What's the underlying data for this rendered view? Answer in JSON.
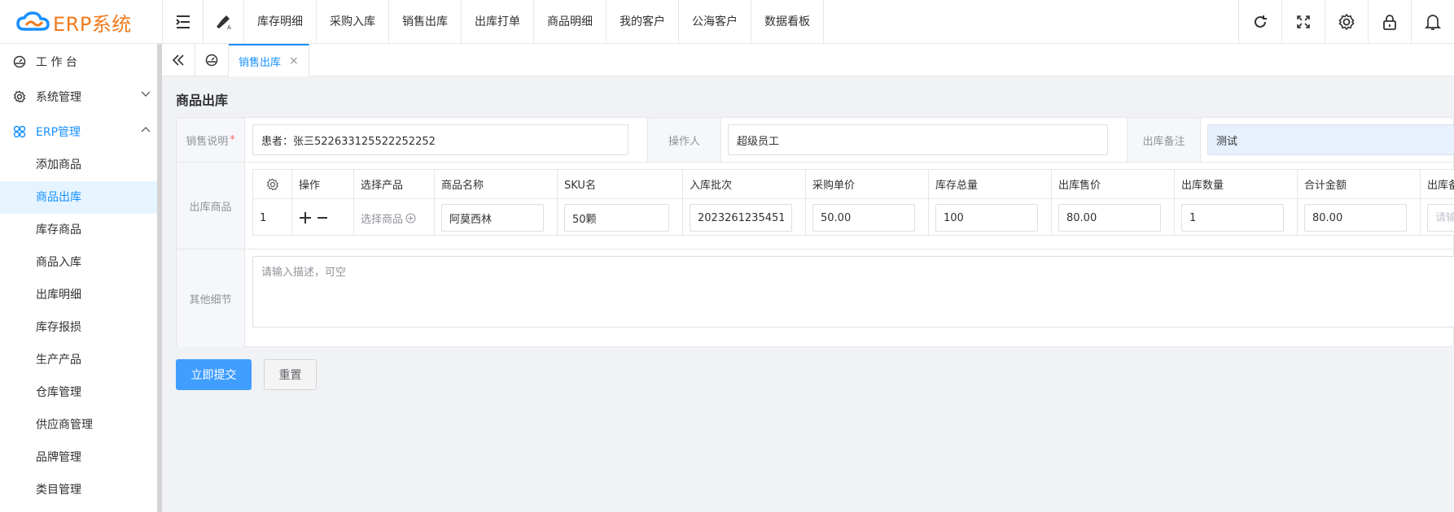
{
  "brand": {
    "name": "ERP系统",
    "color": "#f07b1e",
    "cloud_color": "#1890ff"
  },
  "header": {
    "tools": [
      "menu-fold-icon",
      "clean-icon"
    ],
    "nav": [
      "库存明细",
      "采购入库",
      "销售出库",
      "出库打单",
      "商品明细",
      "我的客户",
      "公海客户",
      "数据看板"
    ],
    "right_icons": [
      "refresh-icon",
      "fullscreen-icon",
      "settings-icon",
      "lock-icon",
      "bell-icon"
    ]
  },
  "sidebar": {
    "items": [
      {
        "label": "工 作 台",
        "icon": "dashboard-icon"
      },
      {
        "label": "系统管理",
        "icon": "system-gear-icon",
        "expanded": false
      },
      {
        "label": "ERP管理",
        "icon": "erp-cluster-icon",
        "expanded": true
      }
    ],
    "sub_items": [
      "添加商品",
      "商品出库",
      "库存商品",
      "商品入库",
      "出库明细",
      "库存报损",
      "生产产品",
      "仓库管理",
      "供应商管理",
      "品牌管理",
      "类目管理"
    ],
    "active_sub": "商品出库",
    "accent": "#1890ff"
  },
  "tabs": {
    "active_label": "销售出库",
    "close": "×"
  },
  "page": {
    "title": "商品出库",
    "form": {
      "sales_note_label": "销售说明",
      "required_mark": "*",
      "sales_note_value": "患者：张三522633125522252252",
      "operator_label": "操作人",
      "operator_value": "超级员工",
      "remark_label": "出库备注",
      "remark_value": "测试",
      "products_label": "出库商品",
      "details_label": "其他细节",
      "details_placeholder": "请输入描述，可空"
    },
    "product_table": {
      "columns": [
        "操作",
        "选择产品",
        "商品名称",
        "SKU名",
        "入库批次",
        "采购单价",
        "库存总量",
        "出库售价",
        "出库数量",
        "合计金额",
        "出库备注"
      ],
      "rows": [
        {
          "index": "1",
          "pick_label": "选择商品",
          "name": "阿莫西林",
          "sku": "50颗",
          "batch": "2023261235451",
          "purchase_price": "50.00",
          "stock_total": "100",
          "sale_price": "80.00",
          "quantity": "1",
          "total": "80.00",
          "remark_placeholder": "请输入"
        }
      ]
    },
    "buttons": {
      "submit": "立即提交",
      "reset": "重置"
    }
  }
}
